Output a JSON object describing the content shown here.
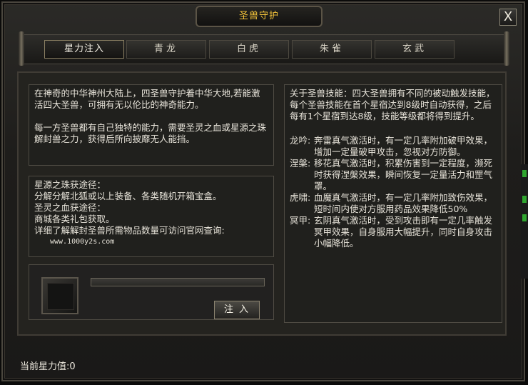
{
  "window": {
    "title": "圣兽守护",
    "close_label": "X"
  },
  "tabs": [
    {
      "label": "星力注入",
      "active": true
    },
    {
      "label": "青龙"
    },
    {
      "label": "白虎"
    },
    {
      "label": "朱雀"
    },
    {
      "label": "玄武"
    }
  ],
  "intro": {
    "para1": "在神奇的中华神州大陆上，四圣兽守护着中华大地,若能激活四大圣兽，可拥有无以伦比的神奇能力。",
    "para2": "每一方圣兽都有自己独特的能力，需要圣灵之血或星源之珠解封兽之力，获得后所向披靡无人能挡。"
  },
  "sources": {
    "line1": "星源之珠获途径：",
    "line2": "分解分解北狐或以上装备、各类随机开箱宝盒。",
    "line3": "圣灵之血获途径：",
    "line4": "商城各类礼包获取。",
    "line5": "详细了解解封圣兽所需物品数量可访问官网查询:",
    "url": "www.1000y2s.com"
  },
  "skills": {
    "intro": "关于圣兽技能：四大圣兽拥有不同的被动触发技能，每个圣兽技能在首个星宿达到8级时自动获得，之后每有1个星宿到达8级，技能等级都将得到提升。",
    "list": [
      {
        "name": "龙吟:",
        "desc": "奔雷真气激活时，有一定几率附加破甲效果，增加一定量破甲攻击，忽视对方防御。"
      },
      {
        "name": "涅槃:",
        "desc": "移花真气激活时，积累伤害到一定程度，濒死时获得涅槃效果，瞬间恢复一定量活力和罡气罩。"
      },
      {
        "name": "虎啸:",
        "desc": "血魔真气激活时，有一定几率附加致伤效果，短时间内使对方服用药品效果降低50%"
      },
      {
        "name": "冥甲:",
        "desc": "玄阴真气激活时，受到攻击即有一定几率触发冥甲效果，自身服用大幅提升，同时自身攻击小幅降低。"
      }
    ]
  },
  "inject": {
    "button_label": "注入",
    "progress": 0
  },
  "status": {
    "label": "当前星力值:",
    "value": "0"
  },
  "colors": {
    "title": "#f2c23a",
    "accent_green": "#3fbf3f"
  }
}
